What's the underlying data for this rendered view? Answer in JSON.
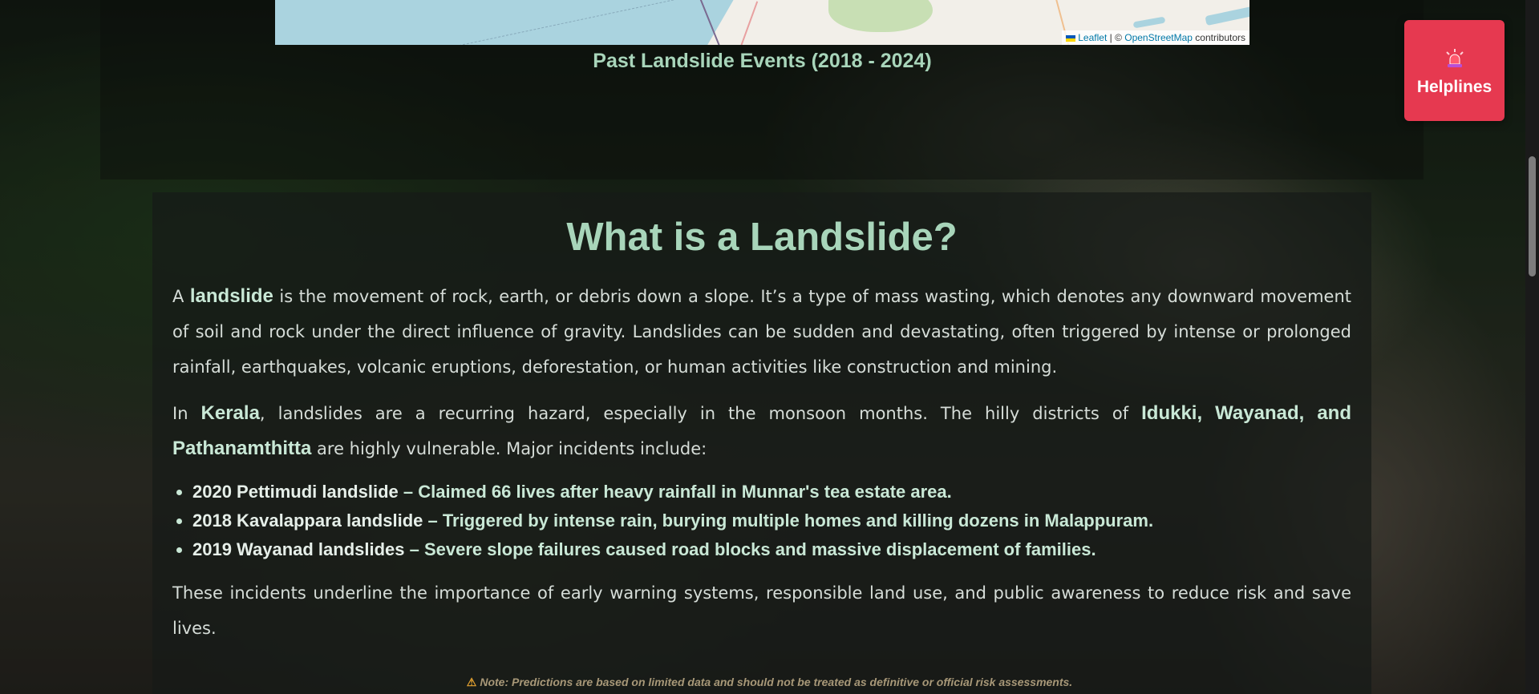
{
  "map": {
    "attribution_leaflet": "Leaflet",
    "attribution_sep": " | © ",
    "attribution_osm": "OpenStreetMap",
    "attribution_suffix": " contributors",
    "caption": "Past Landslide Events (2018 - 2024)"
  },
  "helplines": {
    "label": "Helplines",
    "icon": "siren-icon",
    "color": "#e63950"
  },
  "article": {
    "title": "What is a Landslide?",
    "p1": {
      "pre": "A ",
      "bold": "landslide",
      "post": " is the movement of rock, earth, or debris down a slope. It’s a type of mass wasting, which denotes any downward movement of soil and rock under the direct influence of gravity. Landslides can be sudden and devastating, often triggered by intense or prolonged rainfall, earthquakes, volcanic eruptions, deforestation, or human activities like construction and mining."
    },
    "p2": {
      "pre": "In ",
      "bold1": "Kerala",
      "mid": ", landslides are a recurring hazard, especially in the monsoon months. The hilly districts of ",
      "bold2": "Idukki, Wayanad, and Pathanamthitta",
      "post": " are highly vulnerable. Major incidents include:"
    },
    "incidents": [
      {
        "title": "2020 Pettimudi landslide",
        "desc": " – Claimed 66 lives after heavy rainfall in Munnar's tea estate area."
      },
      {
        "title": "2018 Kavalappara landslide",
        "desc": " – Triggered by intense rain, burying multiple homes and killing dozens in Malappuram."
      },
      {
        "title": "2019 Wayanad landslides",
        "desc": " – Severe slope failures caused road blocks and massive displacement of families."
      }
    ],
    "p3": "These incidents underline the importance of early warning systems, responsible land use, and public awareness to reduce risk and save lives."
  },
  "note": {
    "icon": "warning-icon",
    "text": "Note: Predictions are based on limited data and should not be treated as definitive or official risk assessments."
  },
  "colors": {
    "accent": "#a8d5ba",
    "helpline": "#e63950"
  }
}
